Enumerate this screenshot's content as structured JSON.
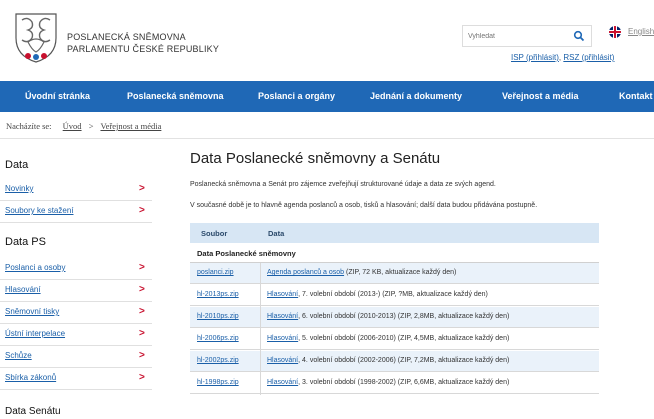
{
  "header": {
    "brand_line1": "POSLANECKÁ SNĚMOVNA",
    "brand_line2": "PARLAMENTU ČESKÉ REPUBLIKY",
    "search_placeholder": "Vyhledat",
    "language_label": "English",
    "login_links": [
      "ISP (přihlásit)",
      "RSZ (přihlásit)"
    ],
    "login_sep": ","
  },
  "nav": {
    "items": [
      "Úvodní stránka",
      "Poslanecká sněmovna",
      "Poslanci a orgány",
      "Jednání a dokumenty",
      "Veřejnost a média",
      "Kontakt"
    ]
  },
  "breadcrumb": {
    "prefix": "Nacházíte se:",
    "items": [
      "Úvod",
      "Veřejnost a média"
    ],
    "separator": ">"
  },
  "sidebar": {
    "sections": [
      {
        "heading": "Data",
        "items": [
          {
            "label": "Novinky",
            "active": false
          },
          {
            "label": "Soubory ke stažení",
            "active": true
          }
        ]
      },
      {
        "heading": "Data PS",
        "items": [
          {
            "label": "Poslanci a osoby"
          },
          {
            "label": "Hlasování"
          },
          {
            "label": "Sněmovní tisky"
          },
          {
            "label": "Ústní interpelace"
          },
          {
            "label": "Schůze"
          },
          {
            "label": "Sbírka zákonů"
          }
        ]
      },
      {
        "heading": "Data Senátu",
        "items": []
      }
    ],
    "chevron": ">"
  },
  "main": {
    "title": "Data Poslanecké sněmovny a Senátu",
    "para1": "Poslanecká sněmovna a Senát pro zájemce zveřejňují strukturované údaje a data ze svých agend.",
    "para2": "V současné době je to hlavně agenda poslanců a osob, tisků a hlasování; další data budou přidávána postupně.",
    "table": {
      "headers": [
        "Soubor",
        "Data"
      ],
      "group": "Data Poslanecké sněmovny",
      "rows": [
        {
          "file": "poslanci.zip",
          "link": "Agenda poslanců a osob",
          "rest": " (ZIP, 72 KB, aktualizace každý den)"
        },
        {
          "file": "hl-2013ps.zip",
          "link": "Hlasování",
          "rest": ", 7. volební období (2013-) (ZIP, ?MB, aktualizace každý den)"
        },
        {
          "file": "hl-2010ps.zip",
          "link": "Hlasování",
          "rest": ", 6. volební období (2010-2013) (ZIP, 2,8MB, aktualizace každý den)"
        },
        {
          "file": "hl-2006ps.zip",
          "link": "Hlasování",
          "rest": ", 5. volební období (2006-2010) (ZIP, 4,5MB, aktualizace každý den)"
        },
        {
          "file": "hl-2002ps.zip",
          "link": "Hlasování",
          "rest": ", 4. volební období (2002-2006) (ZIP, 7,2MB, aktualizace každý den)"
        },
        {
          "file": "hl-1998ps.zip",
          "link": "Hlasování",
          "rest": ", 3. volební období (1998-2002) (ZIP, 6,6MB, aktualizace každý den)"
        }
      ]
    }
  },
  "colors": {
    "nav_bg": "#1f68b6",
    "link": "#1a5fa8",
    "chevron": "#c8102e",
    "table_header": "#d7e6f4",
    "row_alt": "#eaf2fa"
  }
}
